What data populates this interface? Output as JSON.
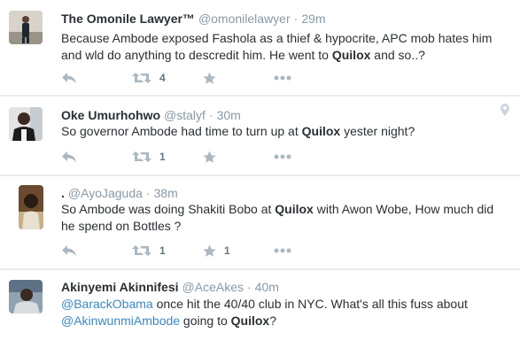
{
  "colors": {
    "background": "#e8ecee",
    "card": "#ffffff",
    "text": "#292f33",
    "muted": "#8899a6",
    "icon": "#aab8c2",
    "mention": "#3b88c3"
  },
  "tweets": [
    {
      "name": "The Omonile Lawyer™",
      "handle": "@omonilelawyer",
      "separator": "·",
      "time": "29m",
      "text_1": "Because Ambode exposed Fashola as a thief & hypocrite, APC mob hates him and wld do anything to descredit him. He went to ",
      "bold": "Quilox",
      "text_2": " and so..?",
      "retweet_count": "4",
      "like_count": "",
      "avatar_icon": "user-avatar-icon"
    },
    {
      "name": "Oke Umurhohwo",
      "handle": "@stalyf",
      "separator": "·",
      "time": "30m",
      "text_1": "So governor Ambode had time to turn up at ",
      "bold": "Quilox",
      "text_2": " yester night?",
      "retweet_count": "1",
      "like_count": "",
      "avatar_icon": "user-avatar-icon",
      "location_icon": "location-pin-icon"
    },
    {
      "name": ".",
      "handle": "@AyoJaguda",
      "separator": "·",
      "time": "38m",
      "text_1": "So Ambode was doing Shakiti Bobo at ",
      "bold": "Quilox",
      "text_2": " with Awon Wobe, How much did he spend on Bottles ?",
      "retweet_count": "1",
      "like_count": "1",
      "avatar_icon": "user-avatar-icon"
    },
    {
      "name": "Akinyemi Akinnifesi",
      "handle": "@AceAkes",
      "separator": "·",
      "time": "40m",
      "mention_1": "@BarackObama",
      "text_1": " once hit the 40/40 club in NYC. What's all this fuss about ",
      "mention_2": "@AkinwunmiAmbode",
      "text_2": " going to ",
      "bold": "Quilox",
      "text_3": "?",
      "avatar_icon": "user-avatar-icon"
    }
  ]
}
